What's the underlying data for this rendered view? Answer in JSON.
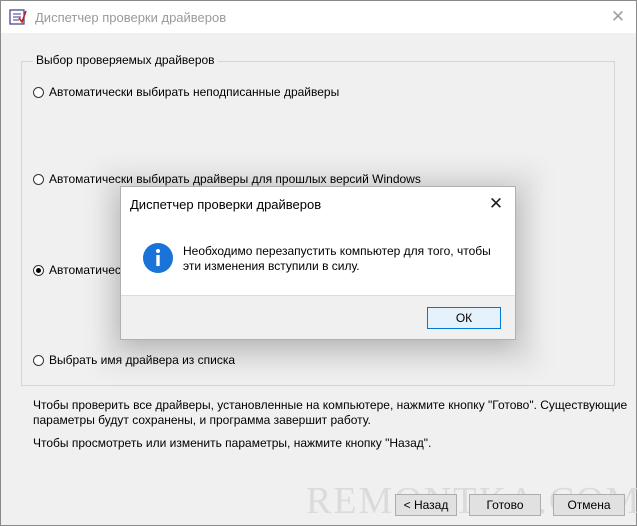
{
  "window": {
    "title": "Диспетчер проверки драйверов",
    "close_glyph": "✕"
  },
  "group": {
    "legend": "Выбор проверяемых драйверов",
    "options": [
      {
        "label": "Автоматически выбирать неподписанные драйверы",
        "checked": false
      },
      {
        "label": "Автоматически выбирать драйверы для прошлых версий Windows",
        "checked": false
      },
      {
        "label": "Автоматически",
        "checked": true
      },
      {
        "label": "Выбрать имя драйвера из списка",
        "checked": false
      }
    ]
  },
  "info": {
    "line1": "Чтобы проверить все драйверы, установленные на компьютере, нажмите кнопку \"Готово\". Существующие",
    "line2": "параметры будут сохранены, и программа завершит работу.",
    "line3": "Чтобы просмотреть или изменить параметры, нажмите кнопку \"Назад\"."
  },
  "buttons": {
    "back": "< Назад",
    "finish": "Готово",
    "cancel": "Отмена"
  },
  "watermark": "REMONTKA.COM",
  "dialog": {
    "title": "Диспетчер проверки драйверов",
    "close_glyph": "✕",
    "message_line1": "Необходимо перезапустить компьютер для того, чтобы",
    "message_line2": "эти изменения вступили в силу.",
    "ok": "ОК",
    "icon": "info-icon",
    "accent": "#1a73d9"
  }
}
